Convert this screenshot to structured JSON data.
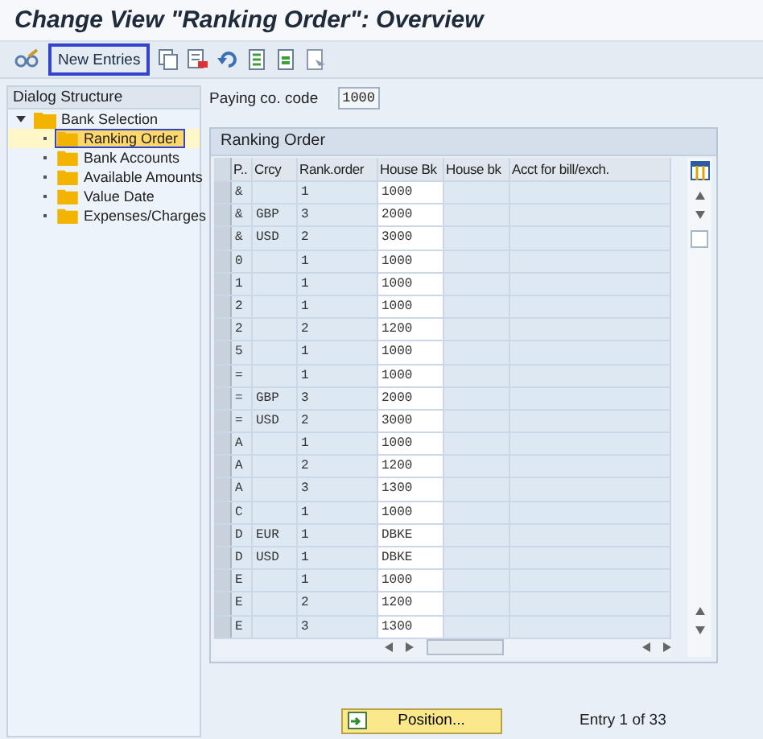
{
  "window": {
    "title": "Change View \"Ranking Order\": Overview"
  },
  "toolbar": {
    "new_entries": {
      "label": "New Entries",
      "highlighted": true
    }
  },
  "dialog_structure": {
    "title": "Dialog Structure",
    "items": [
      {
        "label": "Bank Selection",
        "selected": false,
        "expanded": true,
        "children": [
          {
            "label": "Ranking Order",
            "selected": true
          },
          {
            "label": "Bank Accounts",
            "selected": false
          },
          {
            "label": "Available Amounts",
            "selected": false
          },
          {
            "label": "Value Date",
            "selected": false
          },
          {
            "label": "Expenses/Charges",
            "selected": false
          }
        ]
      }
    ]
  },
  "paying_co_code": {
    "label": "Paying co. code",
    "value": "1000"
  },
  "table": {
    "title": "Ranking Order",
    "columns": [
      "P..",
      "Crcy",
      "Rank.order",
      "House Bk",
      "House bk",
      "Acct for bill/exch."
    ],
    "rows": [
      {
        "p": "&",
        "rank": "1",
        "house_bk": "1000"
      },
      {
        "p": "&",
        "crcy": "GBP",
        "rank": "3",
        "house_bk": "2000"
      },
      {
        "p": "&",
        "crcy": "USD",
        "rank": "2",
        "house_bk": "3000"
      },
      {
        "p": "0",
        "rank": "1",
        "house_bk": "1000"
      },
      {
        "p": "1",
        "rank": "1",
        "house_bk": "1000"
      },
      {
        "p": "2",
        "rank": "1",
        "house_bk": "1000"
      },
      {
        "p": "2",
        "rank": "2",
        "house_bk": "1200"
      },
      {
        "p": "5",
        "rank": "1",
        "house_bk": "1000"
      },
      {
        "p": "=",
        "rank": "1",
        "house_bk": "1000"
      },
      {
        "p": "=",
        "crcy": "GBP",
        "rank": "3",
        "house_bk": "2000"
      },
      {
        "p": "=",
        "crcy": "USD",
        "rank": "2",
        "house_bk": "3000"
      },
      {
        "p": "A",
        "rank": "1",
        "house_bk": "1000"
      },
      {
        "p": "A",
        "rank": "2",
        "house_bk": "1200"
      },
      {
        "p": "A",
        "rank": "3",
        "house_bk": "1300"
      },
      {
        "p": "C",
        "rank": "1",
        "house_bk": "1000"
      },
      {
        "p": "D",
        "crcy": "EUR",
        "rank": "1",
        "house_bk": "DBKE"
      },
      {
        "p": "D",
        "crcy": "USD",
        "rank": "1",
        "house_bk": "DBKE"
      },
      {
        "p": "E",
        "rank": "1",
        "house_bk": "1000"
      },
      {
        "p": "E",
        "rank": "2",
        "house_bk": "1200"
      },
      {
        "p": "E",
        "rank": "3",
        "house_bk": "1300"
      }
    ]
  },
  "position_button": {
    "label": "Position..."
  },
  "entry_info": "Entry 1 of 33"
}
